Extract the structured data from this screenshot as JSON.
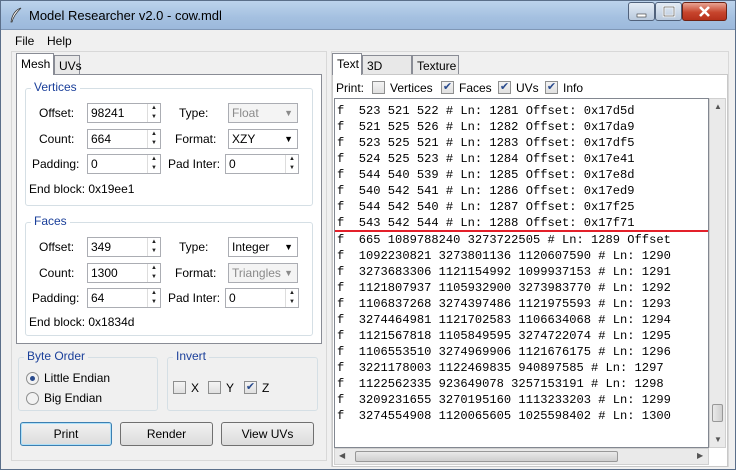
{
  "window": {
    "title": "Model Researcher v2.0 - cow.mdl"
  },
  "menu": [
    "File",
    "Help"
  ],
  "left_tabs": [
    "Mesh",
    "UVs"
  ],
  "vertices": {
    "legend": "Vertices",
    "offset_label": "Offset:",
    "offset_value": "98241",
    "count_label": "Count:",
    "count_value": "664",
    "padding_label": "Padding:",
    "padding_value": "0",
    "type_label": "Type:",
    "type_value": "Float",
    "format_label": "Format:",
    "format_value": "XZY",
    "pad_inter_label": "Pad Inter:",
    "pad_inter_value": "0",
    "end_block": "End block: 0x19ee1"
  },
  "faces": {
    "legend": "Faces",
    "offset_label": "Offset:",
    "offset_value": "349",
    "count_label": "Count:",
    "count_value": "1300",
    "padding_label": "Padding:",
    "padding_value": "64",
    "type_label": "Type:",
    "type_value": "Integer",
    "format_label": "Format:",
    "format_value": "Triangles",
    "pad_inter_label": "Pad Inter:",
    "pad_inter_value": "0",
    "end_block": "End block: 0x1834d"
  },
  "byte_order": {
    "legend": "Byte Order",
    "little": "Little Endian",
    "big": "Big Endian",
    "selected": "Little Endian"
  },
  "invert": {
    "legend": "Invert",
    "x": "X",
    "y": "Y",
    "z": "Z",
    "z_checked": true
  },
  "buttons": {
    "print": "Print",
    "render": "Render",
    "view_uvs": "View UVs"
  },
  "right_tabs": [
    "Text",
    "3D View",
    "Texture"
  ],
  "print_options": {
    "label": "Print:",
    "vertices": "Vertices",
    "faces": "Faces",
    "uvs": "UVs",
    "info": "Info",
    "vertices_checked": false,
    "faces_checked": true,
    "uvs_checked": true,
    "info_checked": true
  },
  "text_lines": [
    "f  523 521 522 # Ln: 1281 Offset: 0x17d5d",
    "f  521 525 526 # Ln: 1282 Offset: 0x17da9",
    "f  523 525 521 # Ln: 1283 Offset: 0x17df5",
    "f  524 525 523 # Ln: 1284 Offset: 0x17e41",
    "f  544 540 539 # Ln: 1285 Offset: 0x17e8d",
    "f  540 542 541 # Ln: 1286 Offset: 0x17ed9",
    "f  544 542 540 # Ln: 1287 Offset: 0x17f25",
    "f  543 542 544 # Ln: 1288 Offset: 0x17f71",
    "f  665 1089788240 3273722505 # Ln: 1289 Offset",
    "f  1092230821 3273801136 1120607590 # Ln: 1290",
    "f  3273683306 1121154992 1099937153 # Ln: 1291",
    "f  1121807937 1105932900 3273983770 # Ln: 1292",
    "f  1106837268 3274397486 1121975593 # Ln: 1293",
    "f  3274464981 1121702583 1106634068 # Ln: 1294",
    "f  1121567818 1105849595 3274722074 # Ln: 1295",
    "f  1106553510 3274969906 1121676175 # Ln: 1296",
    "f  3221178003 1122469835 940897585 # Ln: 1297",
    "f  1122562335 923649078 3257153191 # Ln: 1298",
    "f  3209231655 3270195160 1113233203 # Ln: 1299",
    "f  3274554908 1120065605 1025598402 # Ln: 1300"
  ],
  "colors": {
    "separator": "#e3202a",
    "legend_text": "#1a3f9a"
  }
}
